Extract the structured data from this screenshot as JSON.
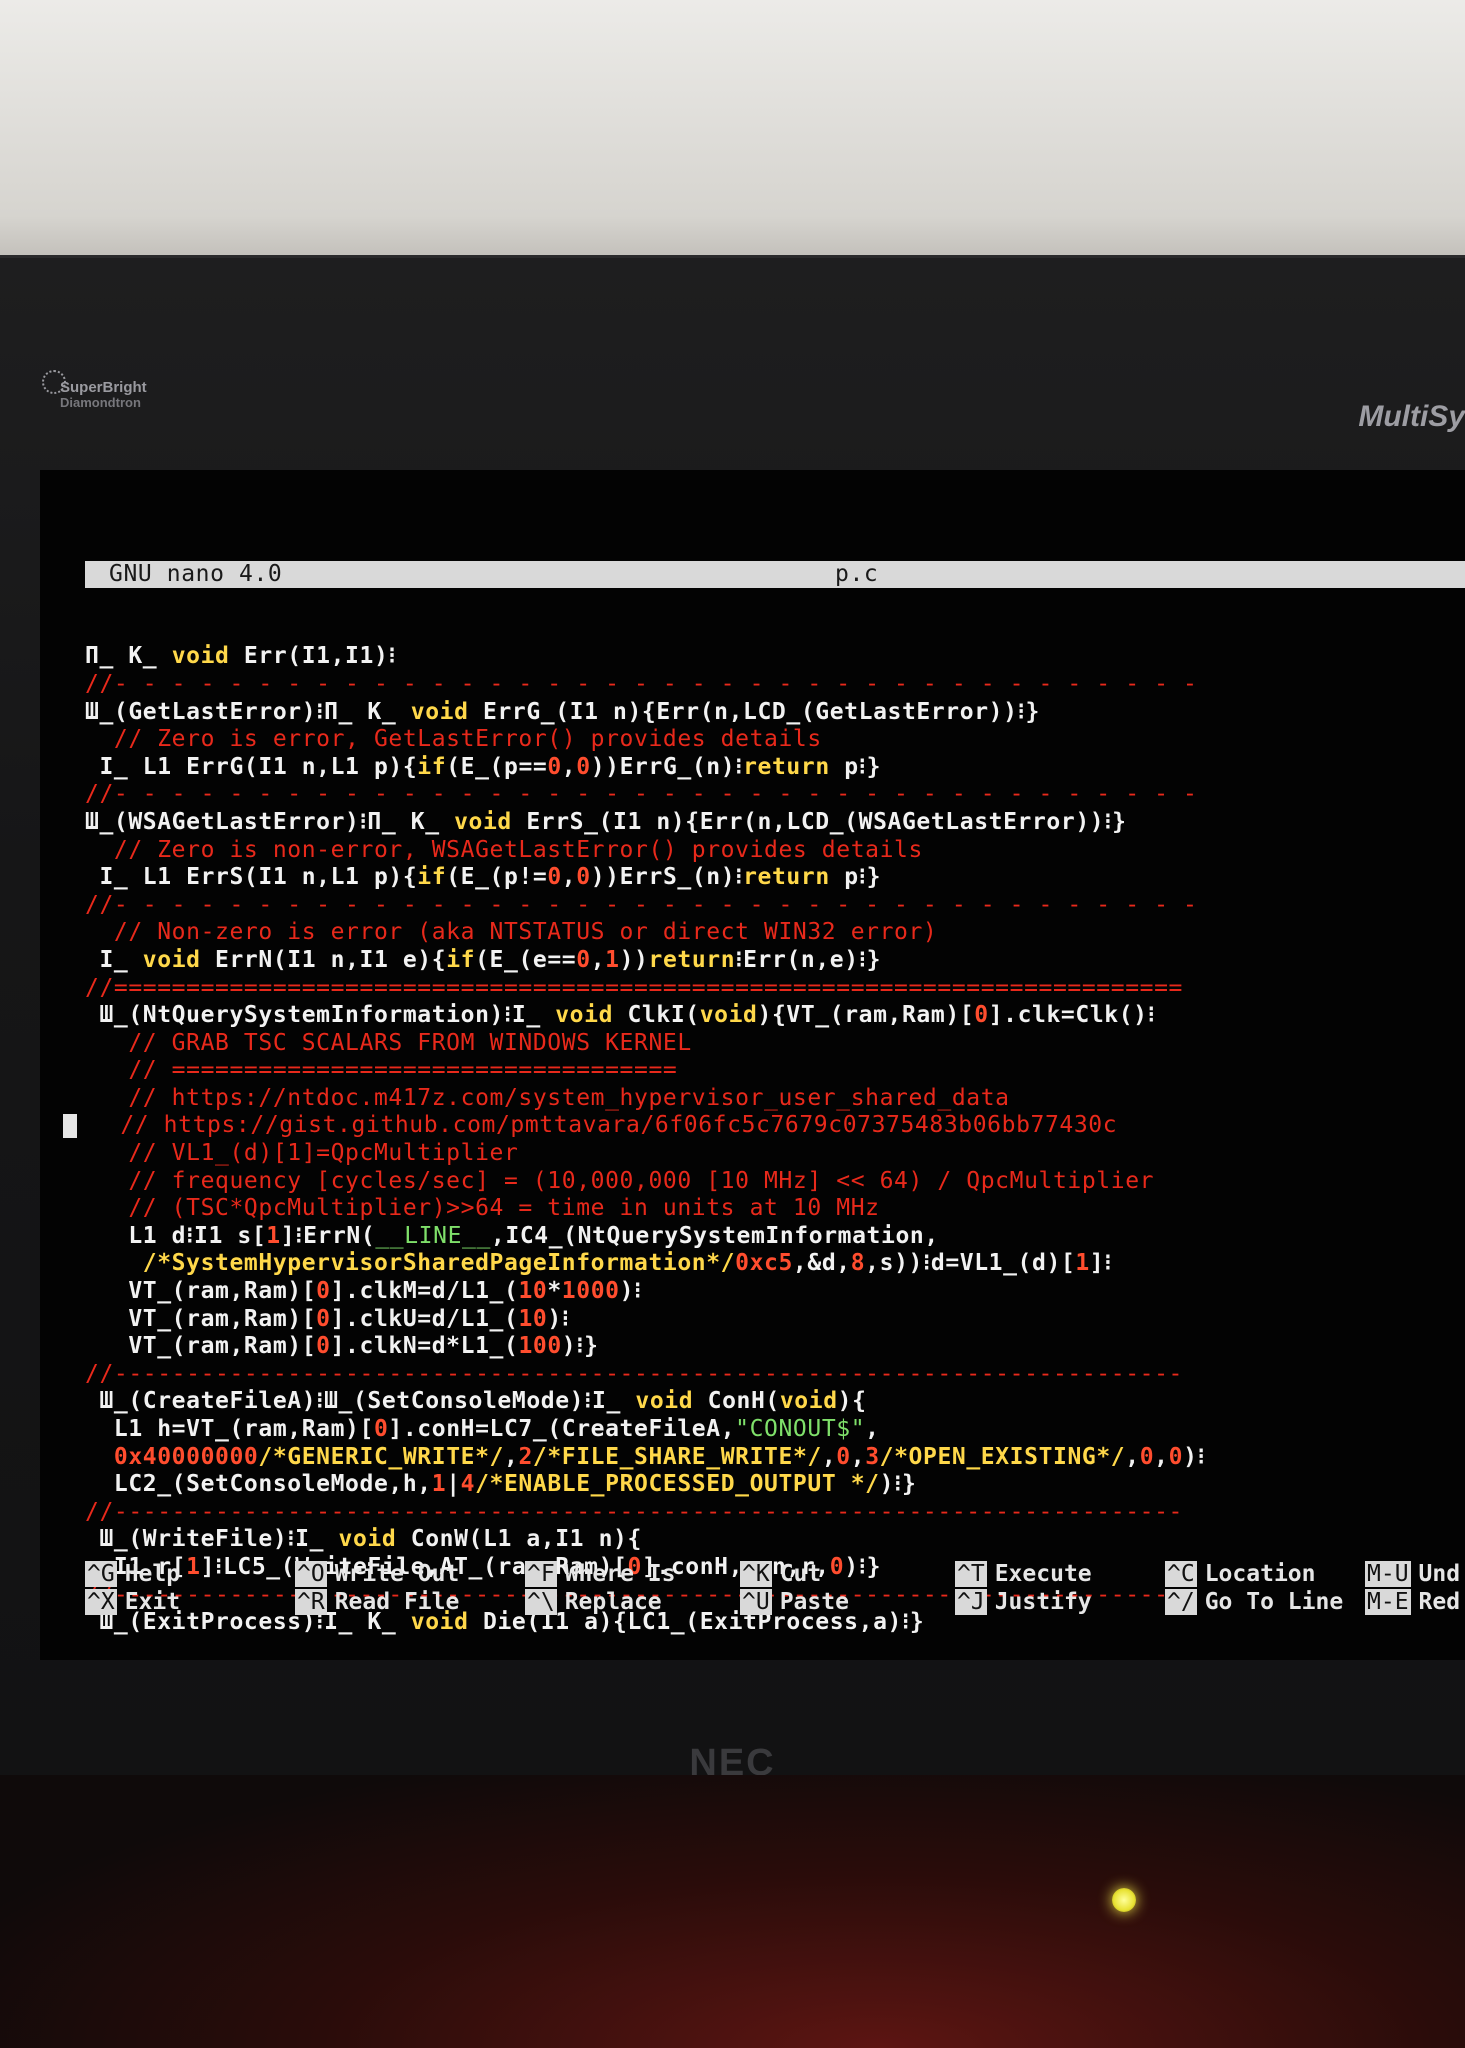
{
  "monitor": {
    "logo_line1": "SuperBright",
    "logo_line2": "Diamondtron",
    "model": "MultiSy",
    "brand": "NEC"
  },
  "nano": {
    "version": "GNU nano 4.0",
    "filename": "p.c"
  },
  "code_lines": [
    [
      [
        "w",
        "Π_ K_ "
      ],
      [
        "k",
        "void"
      ],
      [
        "w",
        " Err(I1,I1)⁝"
      ]
    ],
    [
      [
        "c",
        "//- - - - - - - - - - - - - - - - - - - - - - - - - - - - - - - - - - - - - -"
      ]
    ],
    [
      [
        "w",
        "Ш_(GetLastError)⁝Π_ K_ "
      ],
      [
        "k",
        "void"
      ],
      [
        "w",
        " ErrG_(I1 n){Err(n,LCD_(GetLastError))⁝}"
      ]
    ],
    [
      [
        "c",
        "  // Zero is error, GetLastError() provides details"
      ]
    ],
    [
      [
        "w",
        " I_ L1 ErrG(I1 n,L1 p){"
      ],
      [
        "k",
        "if"
      ],
      [
        "w",
        "(E_(p=="
      ],
      [
        "n",
        "0"
      ],
      [
        "w",
        ","
      ],
      [
        "n",
        "0"
      ],
      [
        "w",
        "))ErrG_(n)⁝"
      ],
      [
        "k",
        "return"
      ],
      [
        "w",
        " p⁝}"
      ]
    ],
    [
      [
        "c",
        "//- - - - - - - - - - - - - - - - - - - - - - - - - - - - - - - - - - - - - -"
      ]
    ],
    [
      [
        "w",
        "Ш_(WSAGetLastError)⁝Π_ K_ "
      ],
      [
        "k",
        "void"
      ],
      [
        "w",
        " ErrS_(I1 n){Err(n,LCD_(WSAGetLastError))⁝}"
      ]
    ],
    [
      [
        "c",
        "  // Zero is non-error, WSAGetLastError() provides details"
      ]
    ],
    [
      [
        "w",
        " I_ L1 ErrS(I1 n,L1 p){"
      ],
      [
        "k",
        "if"
      ],
      [
        "w",
        "(E_(p!="
      ],
      [
        "n",
        "0"
      ],
      [
        "w",
        ","
      ],
      [
        "n",
        "0"
      ],
      [
        "w",
        "))ErrS_(n)⁝"
      ],
      [
        "k",
        "return"
      ],
      [
        "w",
        " p⁝}"
      ]
    ],
    [
      [
        "c",
        "//- - - - - - - - - - - - - - - - - - - - - - - - - - - - - - - - - - - - - -"
      ]
    ],
    [
      [
        "c",
        "  // Non-zero is error (aka NTSTATUS or direct WIN32 error)"
      ]
    ],
    [
      [
        "w",
        " I_ "
      ],
      [
        "k",
        "void"
      ],
      [
        "w",
        " ErrN(I1 n,I1 e){"
      ],
      [
        "k",
        "if"
      ],
      [
        "w",
        "(E_(e=="
      ],
      [
        "n",
        "0"
      ],
      [
        "w",
        ","
      ],
      [
        "n",
        "1"
      ],
      [
        "w",
        "))"
      ],
      [
        "k",
        "return"
      ],
      [
        "w",
        "⁝Err(n,e)⁝}"
      ]
    ],
    [
      [
        "c",
        "//=========================================================================="
      ]
    ],
    [
      [
        "w",
        " Ш_(NtQuerySystemInformation)⁝I_ "
      ],
      [
        "k",
        "void"
      ],
      [
        "w",
        " ClkI("
      ],
      [
        "k",
        "void"
      ],
      [
        "w",
        "){VT_(ram,Ram)["
      ],
      [
        "n",
        "0"
      ],
      [
        "w",
        "].clk=Clk()⁝"
      ]
    ],
    [
      [
        "c",
        "   // GRAB TSC SCALARS FROM WINDOWS KERNEL"
      ]
    ],
    [
      [
        "c",
        "   // ==================================="
      ]
    ],
    [
      [
        "c",
        "   // https://ntdoc.m417z.com/system_hypervisor_user_shared_data"
      ]
    ],
    [
      [
        "c",
        "   // https://gist.github.com/pmttavara/6f06fc5c7679c07375483b06bb77430c"
      ]
    ],
    [
      [
        "c",
        "   // VL1_(d)[1]=QpcMultiplier"
      ]
    ],
    [
      [
        "c",
        "   // frequency [cycles/sec] = (10,000,000 [10 MHz] << 64) / QpcMultiplier"
      ]
    ],
    [
      [
        "c",
        "   // (TSC*QpcMultiplier)>>64 = time in units at 10 MHz"
      ]
    ],
    [
      [
        "w",
        "   L1 d⁝I1 s["
      ],
      [
        "n",
        "1"
      ],
      [
        "w",
        "]⁝ErrN("
      ],
      [
        "g",
        "__LINE__"
      ],
      [
        "w",
        ",IC4_(NtQuerySystemInformation,"
      ]
    ],
    [
      [
        "s",
        "    /*SystemHypervisorSharedPageInformation*/"
      ],
      [
        "n",
        "0xc5"
      ],
      [
        "w",
        ",&d,"
      ],
      [
        "n",
        "8"
      ],
      [
        "w",
        ",s))⁝d=VL1_(d)["
      ],
      [
        "n",
        "1"
      ],
      [
        "w",
        "]⁝"
      ]
    ],
    [
      [
        "w",
        "   VT_(ram,Ram)["
      ],
      [
        "n",
        "0"
      ],
      [
        "w",
        "].clkM=d/L1_("
      ],
      [
        "n",
        "10"
      ],
      [
        "w",
        "*"
      ],
      [
        "n",
        "1000"
      ],
      [
        "w",
        ")⁝"
      ]
    ],
    [
      [
        "w",
        "   VT_(ram,Ram)["
      ],
      [
        "n",
        "0"
      ],
      [
        "w",
        "].clkU=d/L1_("
      ],
      [
        "n",
        "10"
      ],
      [
        "w",
        ")⁝"
      ]
    ],
    [
      [
        "w",
        "   VT_(ram,Ram)["
      ],
      [
        "n",
        "0"
      ],
      [
        "w",
        "].clkN=d*L1_("
      ],
      [
        "n",
        "100"
      ],
      [
        "w",
        ")⁝}"
      ]
    ],
    [
      [
        "c",
        "//--------------------------------------------------------------------------"
      ]
    ],
    [
      [
        "w",
        " Ш_(CreateFileA)⁝Ш_(SetConsoleMode)⁝I_ "
      ],
      [
        "k",
        "void"
      ],
      [
        "w",
        " ConH("
      ],
      [
        "k",
        "void"
      ],
      [
        "w",
        "){"
      ]
    ],
    [
      [
        "w",
        "  L1 h=VT_(ram,Ram)["
      ],
      [
        "n",
        "0"
      ],
      [
        "w",
        "].conH=LC7_(CreateFileA,"
      ],
      [
        "g",
        "\"CONOUT$\""
      ],
      [
        "w",
        ","
      ]
    ],
    [
      [
        "n",
        "  0x40000000"
      ],
      [
        "s",
        "/*GENERIC_WRITE*/"
      ],
      [
        "w",
        ","
      ],
      [
        "n",
        "2"
      ],
      [
        "s",
        "/*FILE_SHARE_WRITE*/"
      ],
      [
        "w",
        ","
      ],
      [
        "n",
        "0"
      ],
      [
        "w",
        ","
      ],
      [
        "n",
        "3"
      ],
      [
        "s",
        "/*OPEN_EXISTING*/"
      ],
      [
        "w",
        ","
      ],
      [
        "n",
        "0"
      ],
      [
        "w",
        ","
      ],
      [
        "n",
        "0"
      ],
      [
        "w",
        ")⁝"
      ]
    ],
    [
      [
        "w",
        "  LC2_(SetConsoleMode,h,"
      ],
      [
        "n",
        "1"
      ],
      [
        "w",
        "|"
      ],
      [
        "n",
        "4"
      ],
      [
        "s",
        "/*ENABLE_PROCESSED_OUTPUT */"
      ],
      [
        "w",
        ")⁝}"
      ]
    ],
    [
      [
        "c",
        "//--------------------------------------------------------------------------"
      ]
    ],
    [
      [
        "w",
        " Ш_(WriteFile)⁝I_ "
      ],
      [
        "k",
        "void"
      ],
      [
        "w",
        " ConW(L1 a,I1 n){"
      ]
    ],
    [
      [
        "w",
        "  I1 r["
      ],
      [
        "n",
        "1"
      ],
      [
        "w",
        "]⁝LC5_(WriteFile,AT_(ram,Ram)["
      ],
      [
        "n",
        "0"
      ],
      [
        "w",
        "].conH,a,n,r,"
      ],
      [
        "n",
        "0"
      ],
      [
        "w",
        ")⁝}"
      ]
    ],
    [
      [
        "c",
        "//--------------------------------------------------------------------------"
      ]
    ],
    [
      [
        "w",
        " Ш_(ExitProcess)⁝I_ K_ "
      ],
      [
        "k",
        "void"
      ],
      [
        "w",
        " Die(I1 a){LC1_(ExitProcess,a)⁝}"
      ]
    ]
  ],
  "shortcuts": [
    {
      "key1": "^G",
      "label1": "Help",
      "key2": "^X",
      "label2": "Exit"
    },
    {
      "key1": "^O",
      "label1": "Write Out",
      "key2": "^R",
      "label2": "Read File"
    },
    {
      "key1": "^F",
      "label1": "Where Is",
      "key2": "^\\",
      "label2": "Replace"
    },
    {
      "key1": "^K",
      "label1": "Cut",
      "key2": "^U",
      "label2": "Paste"
    },
    {
      "key1": "^T",
      "label1": "Execute",
      "key2": "^J",
      "label2": "Justify"
    },
    {
      "key1": "^C",
      "label1": "Location",
      "key2": "^/",
      "label2": "Go To Line"
    },
    {
      "key1": "M-U",
      "label1": "Und",
      "key2": "M-E",
      "label2": "Red"
    }
  ]
}
